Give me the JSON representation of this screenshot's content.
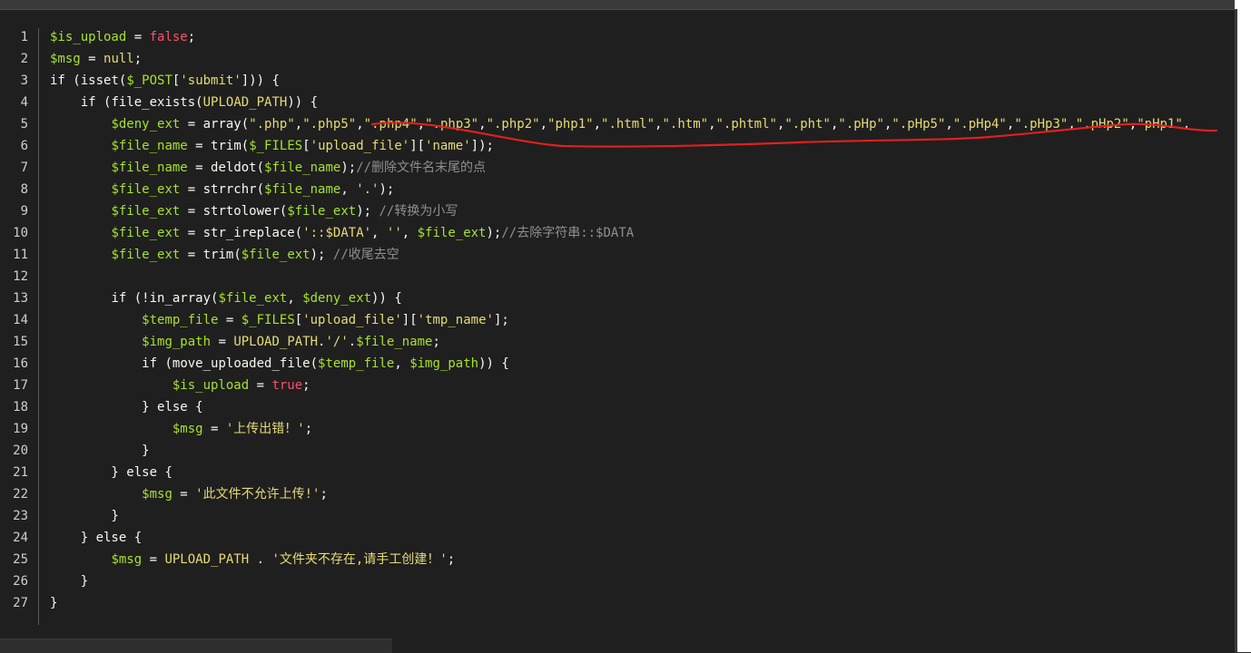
{
  "code": {
    "language": "php",
    "lines": [
      {
        "n": "1",
        "tokens": [
          [
            "v",
            "$is_upload"
          ],
          [
            "o",
            " = "
          ],
          [
            "b",
            "false"
          ],
          [
            "o",
            ";"
          ]
        ]
      },
      {
        "n": "2",
        "tokens": [
          [
            "v",
            "$msg"
          ],
          [
            "o",
            " = "
          ],
          [
            "s",
            "null"
          ],
          [
            "o",
            ";"
          ]
        ]
      },
      {
        "n": "3",
        "tokens": [
          [
            "k",
            "if "
          ],
          [
            "o",
            "("
          ],
          [
            "f",
            "isset"
          ],
          [
            "o",
            "("
          ],
          [
            "v",
            "$_POST"
          ],
          [
            "o",
            "["
          ],
          [
            "s",
            "'submit'"
          ],
          [
            "o",
            "])) {"
          ]
        ]
      },
      {
        "n": "4",
        "tokens": [
          [
            "o",
            "    "
          ],
          [
            "k",
            "if "
          ],
          [
            "o",
            "("
          ],
          [
            "f",
            "file_exists"
          ],
          [
            "o",
            "("
          ],
          [
            "s",
            "UPLOAD_PATH"
          ],
          [
            "o",
            ")) {"
          ]
        ]
      },
      {
        "n": "5",
        "tokens": [
          [
            "o",
            "        "
          ],
          [
            "v",
            "$deny_ext"
          ],
          [
            "o",
            " = "
          ],
          [
            "f",
            "array"
          ],
          [
            "o",
            "("
          ],
          [
            "s",
            "\".php\""
          ],
          [
            "o",
            ","
          ],
          [
            "s",
            "\".php5\""
          ],
          [
            "o",
            ","
          ],
          [
            "s",
            "\".php4\""
          ],
          [
            "o",
            ","
          ],
          [
            "s",
            "\".php3\""
          ],
          [
            "o",
            ","
          ],
          [
            "s",
            "\".php2\""
          ],
          [
            "o",
            ","
          ],
          [
            "s",
            "\"php1\""
          ],
          [
            "o",
            ","
          ],
          [
            "s",
            "\".html\""
          ],
          [
            "o",
            ","
          ],
          [
            "s",
            "\".htm\""
          ],
          [
            "o",
            ","
          ],
          [
            "s",
            "\".phtml\""
          ],
          [
            "o",
            ","
          ],
          [
            "s",
            "\".pht\""
          ],
          [
            "o",
            ","
          ],
          [
            "s",
            "\".pHp\""
          ],
          [
            "o",
            ","
          ],
          [
            "s",
            "\".pHp5\""
          ],
          [
            "o",
            ","
          ],
          [
            "s",
            "\".pHp4\""
          ],
          [
            "o",
            ","
          ],
          [
            "s",
            "\".pHp3\""
          ],
          [
            "o",
            ","
          ],
          [
            "s",
            "\".pHp2\""
          ],
          [
            "o",
            ","
          ],
          [
            "s",
            "\"pHp1\""
          ],
          [
            "o",
            ","
          ]
        ]
      },
      {
        "n": "6",
        "tokens": [
          [
            "o",
            "        "
          ],
          [
            "v",
            "$file_name"
          ],
          [
            "o",
            " = "
          ],
          [
            "f",
            "trim"
          ],
          [
            "o",
            "("
          ],
          [
            "v",
            "$_FILES"
          ],
          [
            "o",
            "["
          ],
          [
            "s",
            "'upload_file'"
          ],
          [
            "o",
            "]["
          ],
          [
            "s",
            "'name'"
          ],
          [
            "o",
            "]);"
          ]
        ]
      },
      {
        "n": "7",
        "tokens": [
          [
            "o",
            "        "
          ],
          [
            "v",
            "$file_name"
          ],
          [
            "o",
            " = "
          ],
          [
            "f",
            "deldot"
          ],
          [
            "o",
            "("
          ],
          [
            "v",
            "$file_name"
          ],
          [
            "o",
            ");"
          ],
          [
            "c",
            "//删除文件名末尾的点"
          ]
        ]
      },
      {
        "n": "8",
        "tokens": [
          [
            "o",
            "        "
          ],
          [
            "v",
            "$file_ext"
          ],
          [
            "o",
            " = "
          ],
          [
            "f",
            "strrchr"
          ],
          [
            "o",
            "("
          ],
          [
            "v",
            "$file_name"
          ],
          [
            "o",
            ", "
          ],
          [
            "s",
            "'.'"
          ],
          [
            "o",
            ");"
          ]
        ]
      },
      {
        "n": "9",
        "tokens": [
          [
            "o",
            "        "
          ],
          [
            "v",
            "$file_ext"
          ],
          [
            "o",
            " = "
          ],
          [
            "f",
            "strtolower"
          ],
          [
            "o",
            "("
          ],
          [
            "v",
            "$file_ext"
          ],
          [
            "o",
            "); "
          ],
          [
            "c",
            "//转换为小写"
          ]
        ]
      },
      {
        "n": "10",
        "tokens": [
          [
            "o",
            "        "
          ],
          [
            "v",
            "$file_ext"
          ],
          [
            "o",
            " = "
          ],
          [
            "f",
            "str_ireplace"
          ],
          [
            "o",
            "("
          ],
          [
            "s",
            "'::$DATA'"
          ],
          [
            "o",
            ", "
          ],
          [
            "s",
            "''"
          ],
          [
            "o",
            ", "
          ],
          [
            "v",
            "$file_ext"
          ],
          [
            "o",
            ");"
          ],
          [
            "c",
            "//去除字符串::$DATA"
          ]
        ]
      },
      {
        "n": "11",
        "tokens": [
          [
            "o",
            "        "
          ],
          [
            "v",
            "$file_ext"
          ],
          [
            "o",
            " = "
          ],
          [
            "f",
            "trim"
          ],
          [
            "o",
            "("
          ],
          [
            "v",
            "$file_ext"
          ],
          [
            "o",
            "); "
          ],
          [
            "c",
            "//收尾去空"
          ]
        ]
      },
      {
        "n": "12",
        "tokens": []
      },
      {
        "n": "13",
        "tokens": [
          [
            "o",
            "        "
          ],
          [
            "k",
            "if "
          ],
          [
            "o",
            "(!"
          ],
          [
            "f",
            "in_array"
          ],
          [
            "o",
            "("
          ],
          [
            "v",
            "$file_ext"
          ],
          [
            "o",
            ", "
          ],
          [
            "v",
            "$deny_ext"
          ],
          [
            "o",
            ")) {"
          ]
        ]
      },
      {
        "n": "14",
        "tokens": [
          [
            "o",
            "            "
          ],
          [
            "v",
            "$temp_file"
          ],
          [
            "o",
            " = "
          ],
          [
            "v",
            "$_FILES"
          ],
          [
            "o",
            "["
          ],
          [
            "s",
            "'upload_file'"
          ],
          [
            "o",
            "]["
          ],
          [
            "s",
            "'tmp_name'"
          ],
          [
            "o",
            "];"
          ]
        ]
      },
      {
        "n": "15",
        "tokens": [
          [
            "o",
            "            "
          ],
          [
            "v",
            "$img_path"
          ],
          [
            "o",
            " = "
          ],
          [
            "s",
            "UPLOAD_PATH"
          ],
          [
            "o",
            "."
          ],
          [
            "s",
            "'/'"
          ],
          [
            "o",
            "."
          ],
          [
            "v",
            "$file_name"
          ],
          [
            "o",
            ";"
          ]
        ]
      },
      {
        "n": "16",
        "tokens": [
          [
            "o",
            "            "
          ],
          [
            "k",
            "if "
          ],
          [
            "o",
            "("
          ],
          [
            "f",
            "move_uploaded_file"
          ],
          [
            "o",
            "("
          ],
          [
            "v",
            "$temp_file"
          ],
          [
            "o",
            ", "
          ],
          [
            "v",
            "$img_path"
          ],
          [
            "o",
            ")) {"
          ]
        ]
      },
      {
        "n": "17",
        "tokens": [
          [
            "o",
            "                "
          ],
          [
            "v",
            "$is_upload"
          ],
          [
            "o",
            " = "
          ],
          [
            "b",
            "true"
          ],
          [
            "o",
            ";"
          ]
        ]
      },
      {
        "n": "18",
        "tokens": [
          [
            "o",
            "            } "
          ],
          [
            "k",
            "else"
          ],
          [
            "o",
            " {"
          ]
        ]
      },
      {
        "n": "19",
        "tokens": [
          [
            "o",
            "                "
          ],
          [
            "v",
            "$msg"
          ],
          [
            "o",
            " = "
          ],
          [
            "s",
            "'上传出错！'"
          ],
          [
            "o",
            ";"
          ]
        ]
      },
      {
        "n": "20",
        "tokens": [
          [
            "o",
            "            }"
          ]
        ]
      },
      {
        "n": "21",
        "tokens": [
          [
            "o",
            "        } "
          ],
          [
            "k",
            "else"
          ],
          [
            "o",
            " {"
          ]
        ]
      },
      {
        "n": "22",
        "tokens": [
          [
            "o",
            "            "
          ],
          [
            "v",
            "$msg"
          ],
          [
            "o",
            " = "
          ],
          [
            "s",
            "'此文件不允许上传!'"
          ],
          [
            "o",
            ";"
          ]
        ]
      },
      {
        "n": "23",
        "tokens": [
          [
            "o",
            "        }"
          ]
        ]
      },
      {
        "n": "24",
        "tokens": [
          [
            "o",
            "    } "
          ],
          [
            "k",
            "else"
          ],
          [
            "o",
            " {"
          ]
        ]
      },
      {
        "n": "25",
        "tokens": [
          [
            "o",
            "        "
          ],
          [
            "v",
            "$msg"
          ],
          [
            "o",
            " = "
          ],
          [
            "s",
            "UPLOAD_PATH"
          ],
          [
            "o",
            " . "
          ],
          [
            "s",
            "'文件夹不存在,请手工创建！'"
          ],
          [
            "o",
            ";"
          ]
        ]
      },
      {
        "n": "26",
        "tokens": [
          [
            "o",
            "    }"
          ]
        ]
      },
      {
        "n": "27",
        "tokens": [
          [
            "o",
            "}"
          ]
        ]
      }
    ]
  },
  "colors": {
    "background": "#1f1f1f",
    "variable": "#a6e22e",
    "string": "#e6db74",
    "boolean": "#fd4f6b",
    "comment": "#8f8f8f",
    "annotation": "#e0201c"
  }
}
